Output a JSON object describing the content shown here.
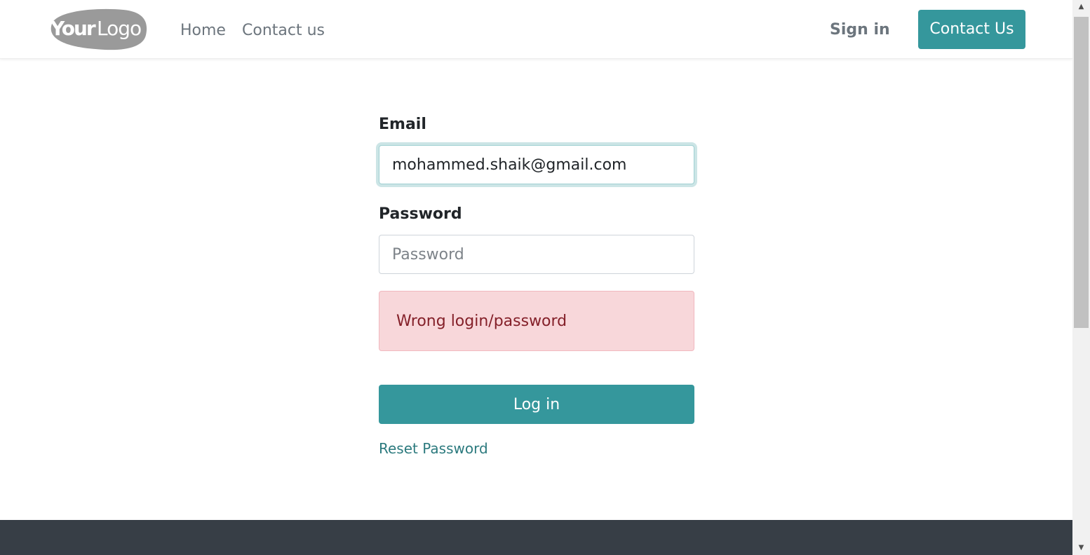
{
  "header": {
    "logo_text": "YourLogo",
    "nav": {
      "home": "Home",
      "contact": "Contact us"
    },
    "sign_in": "Sign in",
    "contact_button": "Contact Us"
  },
  "form": {
    "email_label": "Email",
    "email_value": "mohammed.shaik@gmail.com",
    "password_label": "Password",
    "password_placeholder": "Password",
    "error_message": "Wrong login/password",
    "login_button": "Log in",
    "reset_link": "Reset Password"
  },
  "icons": {
    "scroll_up": "scroll-up-arrow-icon",
    "scroll_down": "scroll-down-arrow-icon"
  },
  "colors": {
    "primary": "#35979c",
    "error_bg": "#f8d7da",
    "error_text": "#842029",
    "footer": "#373e46"
  }
}
